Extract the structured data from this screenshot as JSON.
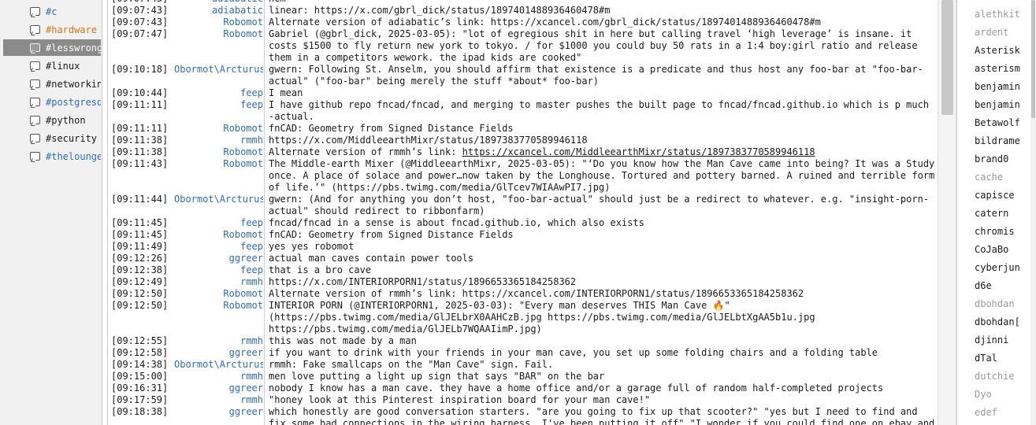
{
  "channels": [
    {
      "name": "#c",
      "color": "#2f6eb5",
      "selected": false
    },
    {
      "name": "#hardware",
      "color": "#d9761a",
      "selected": false
    },
    {
      "name": "#lesswrong",
      "color": "#ffffff",
      "selected": true
    },
    {
      "name": "#linux",
      "color": "#1a1a1a",
      "selected": false
    },
    {
      "name": "#networkin",
      "color": "#1a1a1a",
      "selected": false
    },
    {
      "name": "#postgresq",
      "color": "#2f6eb5",
      "selected": false
    },
    {
      "name": "#python",
      "color": "#1a1a1a",
      "selected": false
    },
    {
      "name": "#security",
      "color": "#1a1a1a",
      "selected": false
    },
    {
      "name": "#thelounge",
      "color": "#2f6eb5",
      "selected": false
    }
  ],
  "messages": [
    {
      "ts": "[09:07:43]",
      "nick": "adiabatic",
      "nick_color": "#2f6eb5",
      "text": "nem"
    },
    {
      "ts": "[09:07:43]",
      "nick": "adiabatic",
      "nick_color": "#2f6eb5",
      "text": "linear: https://x.com/gbrl_dick/status/1897401488936460478#m"
    },
    {
      "ts": "[09:07:43]",
      "nick": "Robomot",
      "nick_color": "#2f6eb5",
      "text": "Alternate version of adiabatic’s link: https://xcancel.com/gbrl_dick/status/1897401488936460478#m"
    },
    {
      "ts": "[09:07:47]",
      "nick": "Robomot",
      "nick_color": "#2f6eb5",
      "text": "Gabriel (@gbrl_dick, 2025-03-05): \"lot of egregious shit in here but calling travel ‘high leverage’ is insane. it costs $1500 to fly return new york to tokyo. / for $1000 you could buy 50 rats in a 1:4 boy:girl ratio and release them in a competitors wework. the ipad kids are cooked\""
    },
    {
      "ts": "[09:10:18]",
      "nick": "Obormot\\Arcturus",
      "nick_color": "#2f6eb5",
      "text": "gwern: Following St. Anselm, you should affirm that existence is a predicate and thus host any foo-bar at \"foo-bar-actual\" (\"foo-bar\" being merely the stuff *about* foo-bar)"
    },
    {
      "ts": "[09:10:44]",
      "nick": "feep",
      "nick_color": "#2f6eb5",
      "text": "I mean"
    },
    {
      "ts": "[09:11:11]",
      "nick": "feep",
      "nick_color": "#2f6eb5",
      "text": "I have github repo fncad/fncad, and merging to master pushes the built page to fncad/fncad.github.io which is p much -actual."
    },
    {
      "ts": "[09:11:11]",
      "nick": "Robomot",
      "nick_color": "#2f6eb5",
      "text": "fnCAD: Geometry from Signed Distance Fields"
    },
    {
      "ts": "[09:11:38]",
      "nick": "rmmh",
      "nick_color": "#2f6eb5",
      "text": "https://x.com/MiddleearthMixr/status/1897383770589946118"
    },
    {
      "ts": "[09:11:38]",
      "nick": "Robomot",
      "nick_color": "#2f6eb5",
      "text": "Alternate version of rmmh’s link: ",
      "link": "https://xcancel.com/MiddleearthMixr/status/1897383770589946118"
    },
    {
      "ts": "[09:11:43]",
      "nick": "Robomot",
      "nick_color": "#2f6eb5",
      "text": "The Middle-earth Mixer (@MiddleearthMixr, 2025-03-05): \"‘Do you know how the Man Cave came into being? It was a Study once. A place of solace and power…now taken by the Longhouse. Tortured and pottery barned. A ruined and terrible form of life.’\" (https://pbs.twimg.com/media/GlTcev7WIAAwPI7.jpg)"
    },
    {
      "ts": "[09:11:44]",
      "nick": "Obormot\\Arcturus",
      "nick_color": "#2f6eb5",
      "text": "gwern: (And for anything you don’t host, \"foo-bar-actual\" should just be a redirect to whatever. e.g. \"insight-porn-actual\" should redirect to ribbonfarm)"
    },
    {
      "ts": "[09:11:45]",
      "nick": "feep",
      "nick_color": "#2f6eb5",
      "text": "fncad/fncad in a sense is about fncad.github.io, which also exists"
    },
    {
      "ts": "[09:11:45]",
      "nick": "Robomot",
      "nick_color": "#2f6eb5",
      "text": "fnCAD: Geometry from Signed Distance Fields"
    },
    {
      "ts": "[09:11:49]",
      "nick": "feep",
      "nick_color": "#2f6eb5",
      "text": "yes yes robomot"
    },
    {
      "ts": "[09:12:26]",
      "nick": "ggreer",
      "nick_color": "#2f6eb5",
      "text": "actual man caves contain power tools"
    },
    {
      "ts": "[09:12:38]",
      "nick": "feep",
      "nick_color": "#2f6eb5",
      "text": "that is a bro cave"
    },
    {
      "ts": "[09:12:49]",
      "nick": "rmmh",
      "nick_color": "#2f6eb5",
      "text": "https://x.com/INTERIORPORN1/status/1896653365184258362"
    },
    {
      "ts": "[09:12:50]",
      "nick": "Robomot",
      "nick_color": "#2f6eb5",
      "text": "Alternate version of rmmh’s link: https://xcancel.com/INTERIORPORN1/status/1896653365184258362"
    },
    {
      "ts": "[09:12:50]",
      "nick": "Robomot",
      "nick_color": "#2f6eb5",
      "text": "INTERIOR PORN (@INTERIORPORN1, 2025-03-03): \"Every man deserves THIS Man Cave 🔥\" (https://pbs.twimg.com/media/GlJELbrX0AAHCzB.jpg https://pbs.twimg.com/media/GlJELbtXgAA5b1u.jpg https://pbs.twimg.com/media/GlJELb7WQAAIimP.jpg)"
    },
    {
      "ts": "[09:12:55]",
      "nick": "rmmh",
      "nick_color": "#2f6eb5",
      "text": "this was not made by a man"
    },
    {
      "ts": "[09:12:58]",
      "nick": "ggreer",
      "nick_color": "#2f6eb5",
      "text": "if you want to drink with your friends in your man cave, you set up some folding chairs and a folding table"
    },
    {
      "ts": "[09:14:38]",
      "nick": "Obormot\\Arcturus",
      "nick_color": "#2f6eb5",
      "text": "rmmh: Fake smallcaps on the \"Man Cave\" sign. Fail."
    },
    {
      "ts": "[09:15:00]",
      "nick": "rmmh",
      "nick_color": "#2f6eb5",
      "text": "men love putting a light up sign that says \"BAR\" on the bar"
    },
    {
      "ts": "[09:16:31]",
      "nick": "ggreer",
      "nick_color": "#2f6eb5",
      "text": "nobody I know has a man cave. they have a home office and/or a garage full of random half-completed projects"
    },
    {
      "ts": "[09:17:59]",
      "nick": "rmmh",
      "nick_color": "#2f6eb5",
      "text": "\"honey look at this Pinterest inspiration board for your man cave!\""
    },
    {
      "ts": "[09:18:38]",
      "nick": "ggreer",
      "nick_color": "#2f6eb5",
      "text": "which honestly are good conversation starters. \"are you going to fix up that scooter?\" \"yes but I need to find and fix some bad connections in the wiring harness. I've been putting it off\" \"I wonder if you could find one on ebay and just replace the whole thing\" \"oh, that's a better idea\""
    }
  ],
  "users": [
    {
      "name": "alethkit",
      "away": true
    },
    {
      "name": "ardent",
      "away": true
    },
    {
      "name": "Asterisk",
      "away": false
    },
    {
      "name": "asterism",
      "away": false
    },
    {
      "name": "benjamin",
      "away": false
    },
    {
      "name": "benjamin",
      "away": false
    },
    {
      "name": "Betawolf",
      "away": false
    },
    {
      "name": "bildrame",
      "away": false
    },
    {
      "name": "brand0",
      "away": false
    },
    {
      "name": "cache",
      "away": true
    },
    {
      "name": "capisce",
      "away": false
    },
    {
      "name": "catern",
      "away": false
    },
    {
      "name": "chromis",
      "away": false
    },
    {
      "name": "CoJaBo",
      "away": false
    },
    {
      "name": "cyberjun",
      "away": false
    },
    {
      "name": "d6e",
      "away": false
    },
    {
      "name": "dbohdan",
      "away": true
    },
    {
      "name": "dbohdan[",
      "away": false
    },
    {
      "name": "djinni",
      "away": false
    },
    {
      "name": "dTal",
      "away": false
    },
    {
      "name": "dutchie",
      "away": true
    },
    {
      "name": "Dyo",
      "away": true
    },
    {
      "name": "edef",
      "away": true
    }
  ],
  "scroll": {
    "thumb_start": 0.0,
    "thumb_fraction": 0.27
  },
  "colors": {
    "selected_bg": "#8a8a8a",
    "nick": "#2f6eb5",
    "hardware": "#d9761a"
  }
}
